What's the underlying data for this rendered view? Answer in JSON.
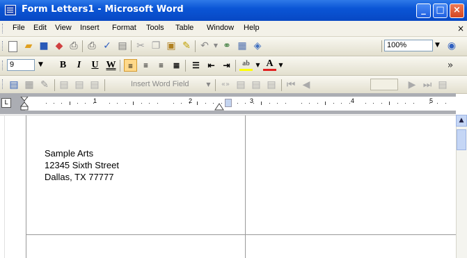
{
  "window": {
    "title": "Form Letters1 - Microsoft Word",
    "minimize": "_",
    "maximize": "□",
    "close": "×"
  },
  "menu": {
    "items": [
      "File",
      "Edit",
      "View",
      "Insert",
      "Format",
      "Tools",
      "Table",
      "Window",
      "Help"
    ],
    "close_glyph": "×"
  },
  "standard_toolbar": {
    "zoom": "100%"
  },
  "formatting_toolbar": {
    "font_size": "9",
    "bold": "B",
    "italic": "I",
    "underline": "U",
    "word_underline": "W",
    "highlight_color": "#ffff00",
    "font_color": "#e02020"
  },
  "mail_merge_toolbar": {
    "insert_word_field": "Insert Word Field"
  },
  "ruler": {
    "numbers": [
      "1",
      "2",
      "3",
      "4",
      "5"
    ]
  },
  "document": {
    "address_lines": [
      "Sample Arts",
      "12345 Sixth Street",
      "Dallas, TX 77777"
    ]
  },
  "colors": {
    "titlebar": "#0a55d6",
    "toolbar": "#ece9d8"
  }
}
